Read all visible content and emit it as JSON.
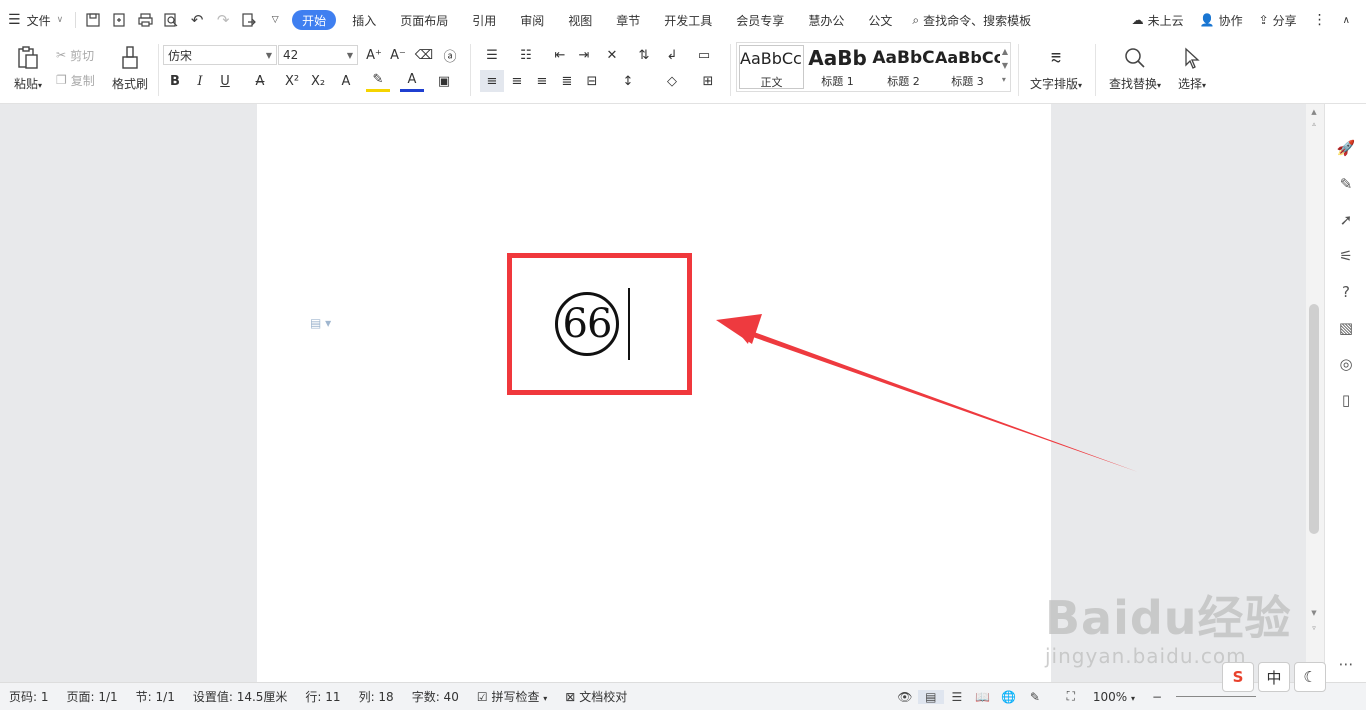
{
  "menubar": {
    "file_label": "文件",
    "tabs": [
      {
        "label": "开始",
        "active": true
      },
      {
        "label": "插入"
      },
      {
        "label": "页面布局"
      },
      {
        "label": "引用"
      },
      {
        "label": "审阅"
      },
      {
        "label": "视图"
      },
      {
        "label": "章节"
      },
      {
        "label": "开发工具"
      },
      {
        "label": "会员专享"
      },
      {
        "label": "慧办公"
      },
      {
        "label": "公文"
      }
    ],
    "search_placeholder": "查找命令、搜索模板",
    "cloud_label": "未上云",
    "collab_label": "协作",
    "share_label": "分享"
  },
  "ribbon": {
    "paste_label": "粘贴",
    "cut_label": "剪切",
    "copy_label": "复制",
    "format_painter_label": "格式刷",
    "font_name": "仿宋",
    "font_size": "42",
    "styles": [
      {
        "preview": "AaBbCcDd",
        "name": "正文"
      },
      {
        "preview": "AaBb",
        "name": "标题 1"
      },
      {
        "preview": "AaBbC",
        "name": "标题 2"
      },
      {
        "preview": "AaBbCcI",
        "name": "标题 3"
      }
    ],
    "text_layout_label": "文字排版",
    "find_replace_label": "查找替换",
    "select_label": "选择"
  },
  "document": {
    "circled_text": "66"
  },
  "statusbar": {
    "page_num": "页码: 1",
    "pages": "页面: 1/1",
    "section": "节: 1/1",
    "setting": "设置值: 14.5厘米",
    "row": "行: 11",
    "col": "列: 18",
    "word_count": "字数: 40",
    "spell_check": "拼写检查",
    "doc_proof": "文档校对",
    "zoom": "100%"
  },
  "ime": {
    "logo": "S",
    "mode": "中"
  },
  "watermark": {
    "line1": "Baidu经验",
    "line2": "jingyan.baidu.com"
  },
  "colors": {
    "accent": "#3f7ff0",
    "highlight_box": "#f0383c",
    "arrow": "#ee3a3f"
  }
}
